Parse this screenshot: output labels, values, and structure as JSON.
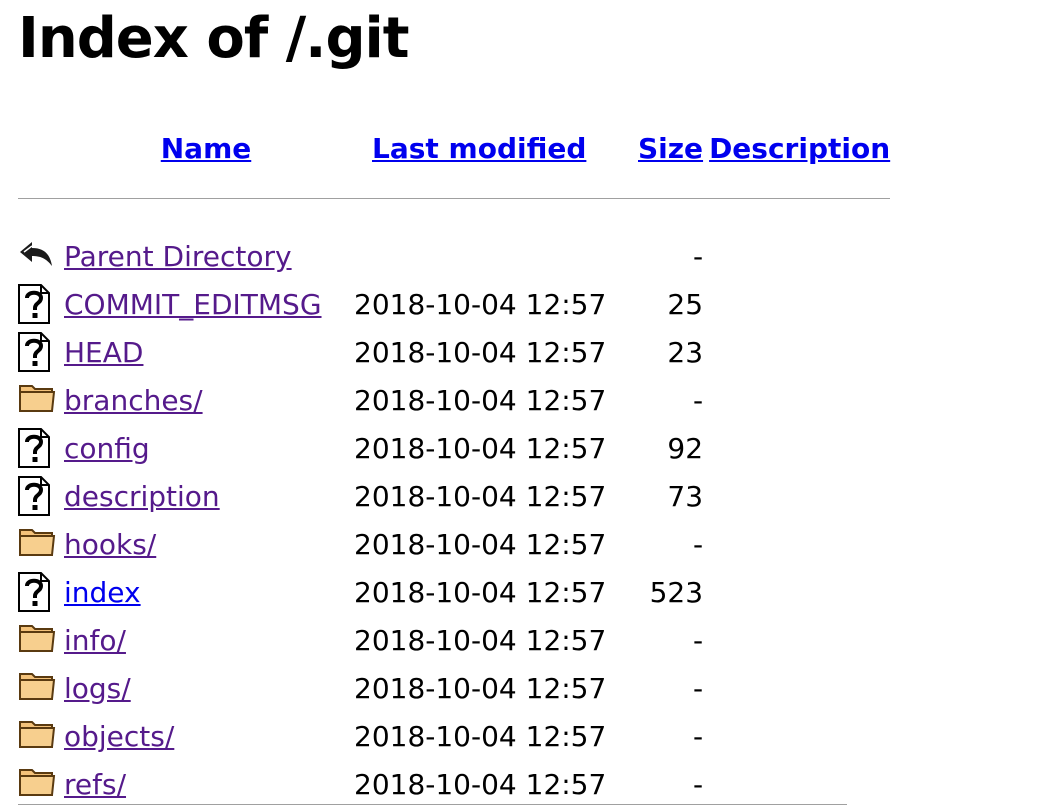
{
  "page": {
    "title": "Index of /.git"
  },
  "columns": {
    "name": "Name",
    "last_modified": "Last modified",
    "size": "Size",
    "description": "Description"
  },
  "entries": [
    {
      "icon": "back-icon",
      "name": "Parent Directory",
      "modified": "",
      "size": "-",
      "desc": "",
      "visited": true
    },
    {
      "icon": "unknown-file-icon",
      "name": "COMMIT_EDITMSG",
      "modified": "2018-10-04 12:57",
      "size": "25",
      "desc": "",
      "visited": true
    },
    {
      "icon": "unknown-file-icon",
      "name": "HEAD",
      "modified": "2018-10-04 12:57",
      "size": "23",
      "desc": "",
      "visited": true
    },
    {
      "icon": "folder-icon",
      "name": "branches/",
      "modified": "2018-10-04 12:57",
      "size": "-",
      "desc": "",
      "visited": true
    },
    {
      "icon": "unknown-file-icon",
      "name": "config",
      "modified": "2018-10-04 12:57",
      "size": "92",
      "desc": "",
      "visited": true
    },
    {
      "icon": "unknown-file-icon",
      "name": "description",
      "modified": "2018-10-04 12:57",
      "size": "73",
      "desc": "",
      "visited": true
    },
    {
      "icon": "folder-icon",
      "name": "hooks/",
      "modified": "2018-10-04 12:57",
      "size": "-",
      "desc": "",
      "visited": true
    },
    {
      "icon": "unknown-file-icon",
      "name": "index",
      "modified": "2018-10-04 12:57",
      "size": "523",
      "desc": "",
      "visited": false
    },
    {
      "icon": "folder-icon",
      "name": "info/",
      "modified": "2018-10-04 12:57",
      "size": "-",
      "desc": "",
      "visited": true
    },
    {
      "icon": "folder-icon",
      "name": "logs/",
      "modified": "2018-10-04 12:57",
      "size": "-",
      "desc": "",
      "visited": true
    },
    {
      "icon": "folder-icon",
      "name": "objects/",
      "modified": "2018-10-04 12:57",
      "size": "-",
      "desc": "",
      "visited": true
    },
    {
      "icon": "folder-icon",
      "name": "refs/",
      "modified": "2018-10-04 12:57",
      "size": "-",
      "desc": "",
      "visited": true
    }
  ],
  "colors": {
    "link": "#0000ee",
    "visited_link": "#551a8b",
    "rule": "#a0a0a0",
    "folder_fill": "#f4c27a"
  }
}
